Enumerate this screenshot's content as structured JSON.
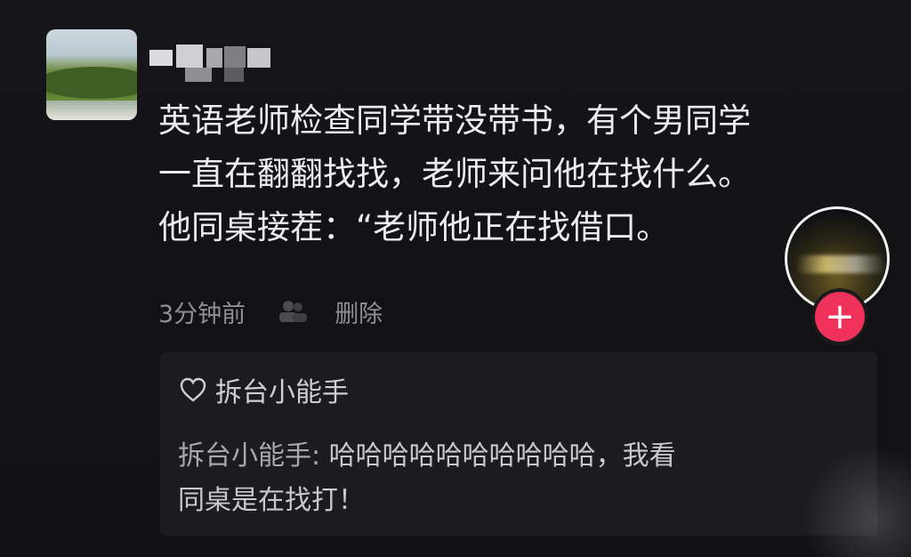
{
  "post": {
    "lines": [
      "英语老师检查同学带没带书，有个男同学",
      "一直在翻翻找找，老师来问他在找什么。",
      "他同桌接茬：“老师他正在找借口。"
    ],
    "time": "3分钟前",
    "delete_label": "删除"
  },
  "creator": {
    "follow_label": "+"
  },
  "reply": {
    "author": "拆台小能手",
    "text_name": "拆台小能手:",
    "text_line1": "哈哈哈哈哈哈哈哈哈哈，我看",
    "text_line2": "同桌是在找打！"
  },
  "colors": {
    "background": "#131316",
    "accent_follow": "#f0325a",
    "text_primary": "#ececee",
    "text_secondary": "#8e8e93"
  },
  "icons": {
    "people": "people-icon",
    "heart": "heart-icon",
    "like": "like-heart-icon"
  }
}
